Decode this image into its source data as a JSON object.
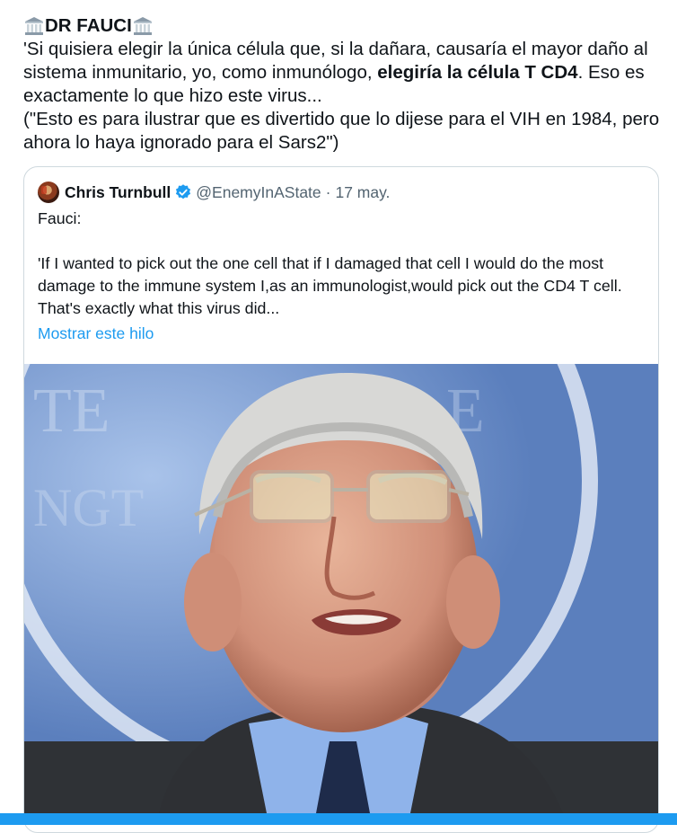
{
  "tweet": {
    "title": "DR FAUCI",
    "title_icon": "classical-building-emoji",
    "text_part1": " 'Si quisiera elegir la única célula que, si la dañara, causaría el mayor daño al sistema inmunitario, yo, como inmunólogo, ",
    "text_bold": "elegiría la célula T CD4",
    "text_part2": ". Eso es exactamente lo que hizo este virus...",
    "note": "(\"Esto es para ilustrar que es divertido que lo dijese para el VIH en 1984, pero ahora lo haya ignorado para el Sars2\")"
  },
  "quote": {
    "author_name": "Chris Turnbull",
    "author_handle": "@EnemyInAState",
    "separator": "·",
    "date": "17 may.",
    "line1": "Fauci:",
    "body": "'If I wanted to pick out the one cell that if I damaged that cell I would do the most damage to the immune system I,as an immunologist,would pick out the CD4 T cell. That's exactly what this virus did...",
    "show_thread": "Mostrar este hilo",
    "verified_icon": "verified-badge-icon",
    "accent_color": "#1d9bf0"
  }
}
